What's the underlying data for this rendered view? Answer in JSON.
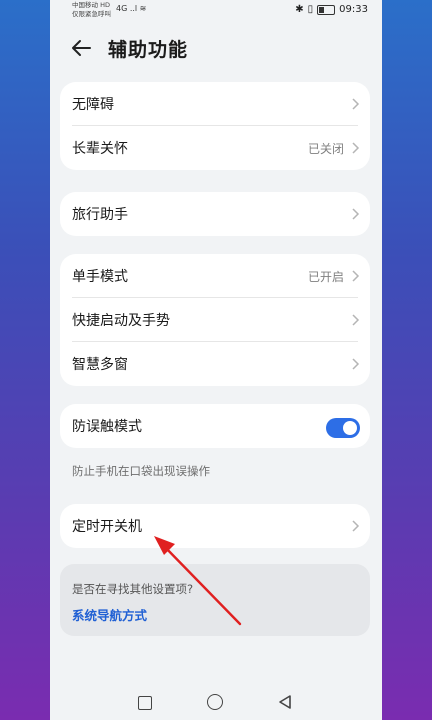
{
  "status_bar": {
    "carrier_line1": "中国移动 HD",
    "carrier_line2": "仅限紧急呼叫",
    "signal": "4G ..l ≋",
    "time": "09:33"
  },
  "header": {
    "title": "辅助功能"
  },
  "groups": [
    {
      "rows": [
        {
          "label": "无障碍",
          "value": ""
        },
        {
          "label": "长辈关怀",
          "value": "已关闭"
        }
      ]
    },
    {
      "rows": [
        {
          "label": "旅行助手",
          "value": ""
        }
      ]
    },
    {
      "rows": [
        {
          "label": "单手模式",
          "value": "已开启"
        },
        {
          "label": "快捷启动及手势",
          "value": ""
        },
        {
          "label": "智慧多窗",
          "value": ""
        }
      ]
    },
    {
      "rows": [
        {
          "label": "防误触模式",
          "value": ""
        }
      ]
    },
    {
      "rows": [
        {
          "label": "定时开关机",
          "value": ""
        }
      ]
    }
  ],
  "toggle_state": "on",
  "hint": "防止手机在口袋出现误操作",
  "suggestion": {
    "question": "是否在寻找其他设置项?",
    "link": "系统导航方式"
  },
  "colors": {
    "accent": "#2d6ee6",
    "link": "#2060d4",
    "annotation_arrow": "#e02020"
  }
}
